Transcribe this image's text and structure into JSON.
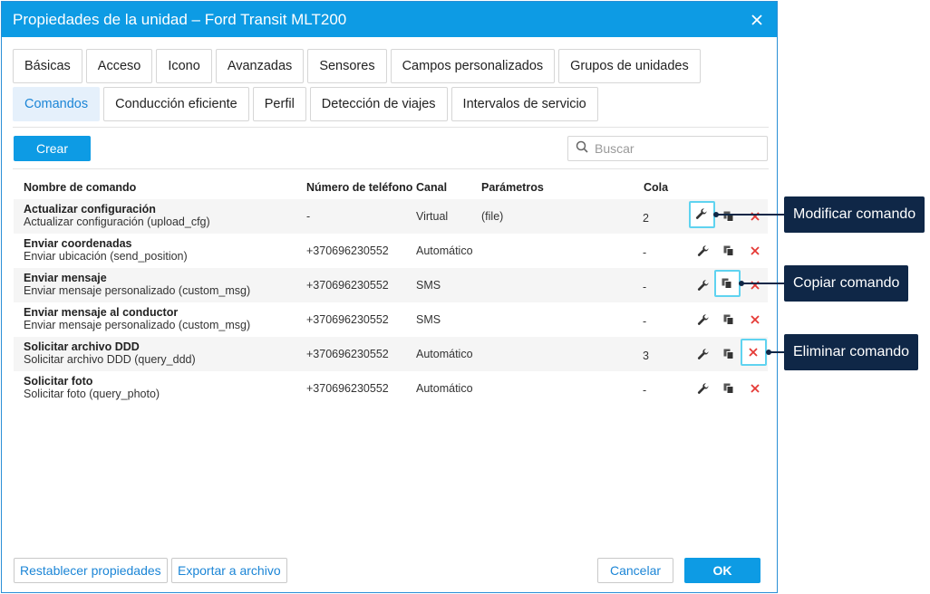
{
  "window": {
    "title": "Propiedades de la unidad – Ford Transit MLT200"
  },
  "tabs_row1": [
    "Básicas",
    "Acceso",
    "Icono",
    "Avanzadas",
    "Sensores",
    "Campos personalizados",
    "Grupos de unidades"
  ],
  "tabs_row2": [
    "Comandos",
    "Conducción eficiente",
    "Perfil",
    "Detección de viajes",
    "Intervalos de servicio"
  ],
  "active_tab": "Comandos",
  "toolbar": {
    "create_label": "Crear",
    "search_placeholder": "Buscar"
  },
  "table": {
    "headers": {
      "name": "Nombre de comando",
      "phone": "Número de teléfono",
      "channel": "Canal",
      "params": "Parámetros",
      "queue": "Cola"
    },
    "rows": [
      {
        "name": "Actualizar configuración",
        "desc": "Actualizar configuración (upload_cfg)",
        "phone": "-",
        "channel": "Virtual",
        "params": "(file)",
        "queue": "2"
      },
      {
        "name": "Enviar coordenadas",
        "desc": "Enviar ubicación (send_position)",
        "phone": "+370696230552",
        "channel": "Automático",
        "params": "",
        "queue": "-"
      },
      {
        "name": "Enviar mensaje",
        "desc": "Enviar mensaje personalizado (custom_msg)",
        "phone": "+370696230552",
        "channel": "SMS",
        "params": "",
        "queue": "-"
      },
      {
        "name": "Enviar mensaje al conductor",
        "desc": "Enviar mensaje personalizado (custom_msg)",
        "phone": "+370696230552",
        "channel": "SMS",
        "params": "",
        "queue": "-"
      },
      {
        "name": "Solicitar archivo DDD",
        "desc": "Solicitar archivo DDD (query_ddd)",
        "phone": "+370696230552",
        "channel": "Automático",
        "params": "",
        "queue": "3"
      },
      {
        "name": "Solicitar foto",
        "desc": "Solicitar foto (query_photo)",
        "phone": "+370696230552",
        "channel": "Automático",
        "params": "",
        "queue": "-"
      }
    ]
  },
  "footer": {
    "reset_label": "Restablecer propiedades",
    "export_label": "Exportar a archivo",
    "cancel_label": "Cancelar",
    "ok_label": "OK"
  },
  "callouts": {
    "edit": "Modificar comando",
    "copy": "Copiar comando",
    "delete": "Eliminar comando"
  },
  "colors": {
    "accent": "#0d9be4",
    "callout": "#0f2747",
    "highlight": "#5fd3f0",
    "delete": "#e53935"
  }
}
